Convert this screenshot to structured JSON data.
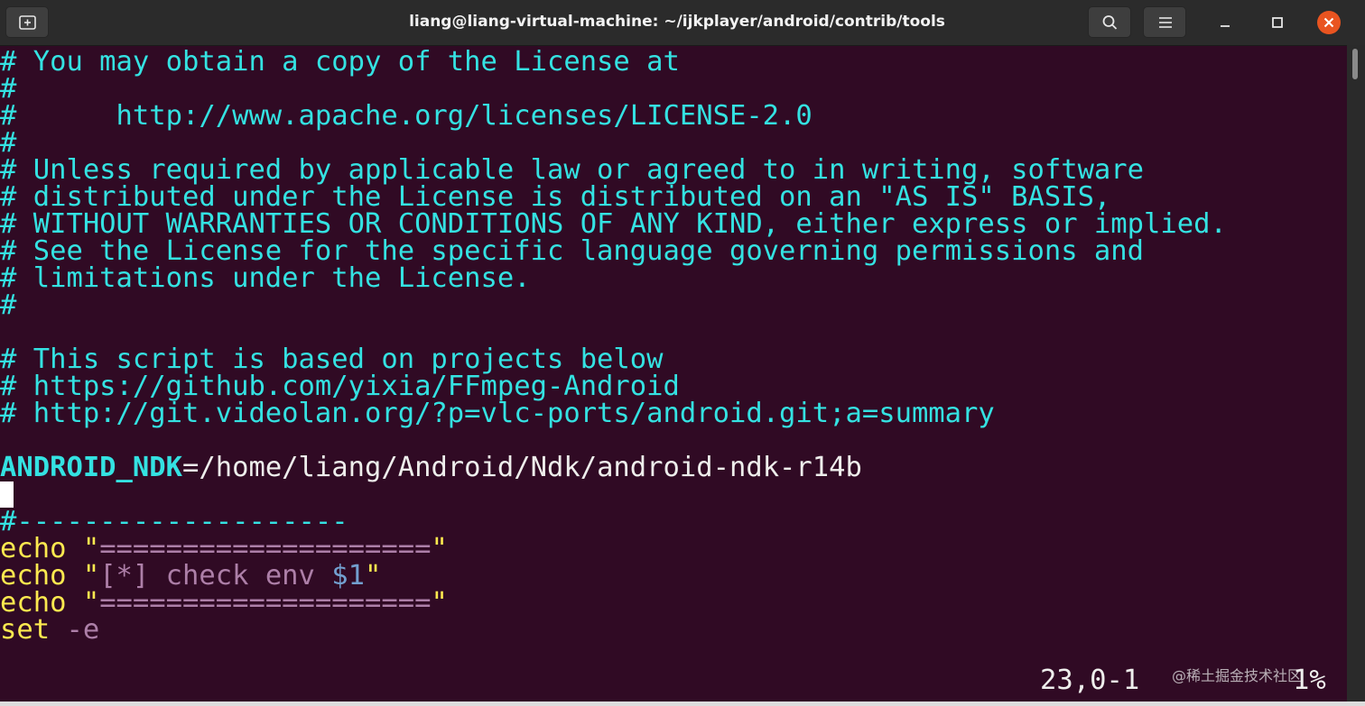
{
  "window": {
    "title": "liang@liang-virtual-machine: ~/ijkplayer/android/contrib/tools"
  },
  "icons": {
    "new_tab": "new-tab-icon",
    "search": "search-icon",
    "menu": "hamburger-menu-icon",
    "minimize": "minimize-icon",
    "maximize": "maximize-icon",
    "close": "close-icon"
  },
  "colors": {
    "background": "#300a24",
    "comment": "#34e2e2",
    "keyword": "#fce94f",
    "string": "#ad7fa8",
    "variable": "#729fcf",
    "close_button": "#e95420"
  },
  "editor": {
    "lines": [
      {
        "kind": "comment",
        "text": "# You may obtain a copy of the License at"
      },
      {
        "kind": "comment",
        "text": "#"
      },
      {
        "kind": "comment",
        "text": "#      http://www.apache.org/licenses/LICENSE-2.0"
      },
      {
        "kind": "comment",
        "text": "#"
      },
      {
        "kind": "comment",
        "text": "# Unless required by applicable law or agreed to in writing, software"
      },
      {
        "kind": "comment",
        "text": "# distributed under the License is distributed on an \"AS IS\" BASIS,"
      },
      {
        "kind": "comment",
        "text": "# WITHOUT WARRANTIES OR CONDITIONS OF ANY KIND, either express or implied."
      },
      {
        "kind": "comment",
        "text": "# See the License for the specific language governing permissions and"
      },
      {
        "kind": "comment",
        "text": "# limitations under the License."
      },
      {
        "kind": "comment",
        "text": "#"
      },
      {
        "kind": "blank",
        "text": ""
      },
      {
        "kind": "comment",
        "text": "# This script is based on projects below"
      },
      {
        "kind": "comment",
        "text": "# https://github.com/yixia/FFmpeg-Android"
      },
      {
        "kind": "comment",
        "text": "# http://git.videolan.org/?p=vlc-ports/android.git;a=summary"
      },
      {
        "kind": "blank",
        "text": ""
      }
    ],
    "assignment": {
      "name": "ANDROID_NDK",
      "value": "=/home/liang/Android/Ndk/android-ndk-r14b"
    },
    "divider": "#--------------------",
    "echo1": {
      "cmd": "echo",
      "q1": " \"",
      "body": "====================",
      "q2": "\""
    },
    "echo2": {
      "cmd": "echo",
      "q1": " \"",
      "body": "[*] check env ",
      "var": "$1",
      "q2": "\""
    },
    "echo3": {
      "cmd": "echo",
      "q1": " \"",
      "body": "====================",
      "q2": "\""
    },
    "set_line": {
      "cmd": "set",
      "arg": " -e"
    },
    "status": {
      "position": "23,0-1",
      "percent": "1%"
    }
  },
  "watermark": "@稀土掘金技术社区"
}
